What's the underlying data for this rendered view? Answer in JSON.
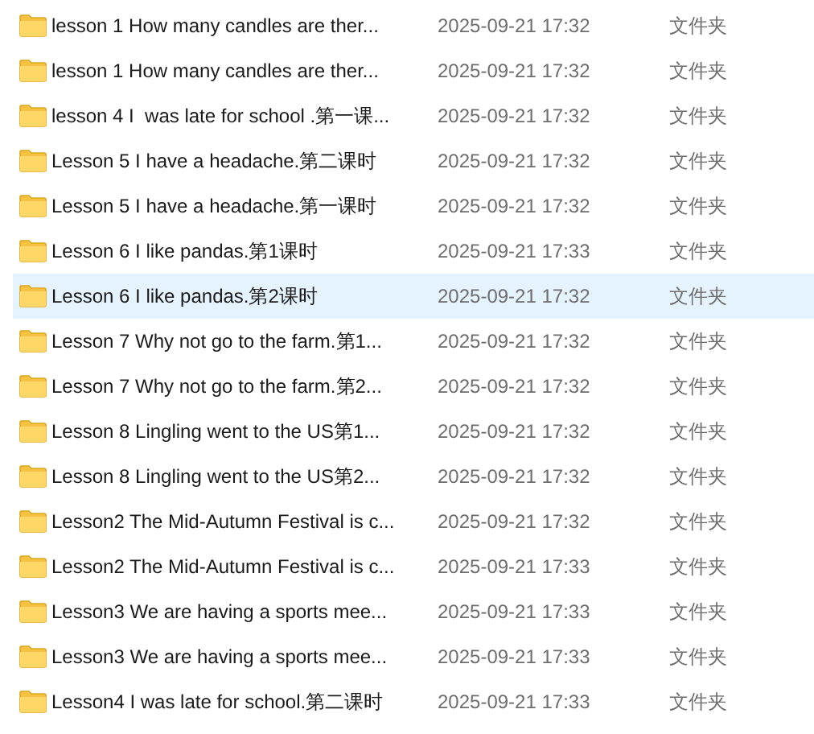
{
  "files": [
    {
      "name": "lesson 1 How many candles are ther...",
      "modified": "2025-09-21 17:32",
      "type": "文件夹",
      "selected": false
    },
    {
      "name": "lesson 1 How many candles are ther...",
      "modified": "2025-09-21 17:32",
      "type": "文件夹",
      "selected": false
    },
    {
      "name": "lesson 4 I  was late for school .第一课...",
      "modified": "2025-09-21 17:32",
      "type": "文件夹",
      "selected": false
    },
    {
      "name": "Lesson 5 I have a headache.第二课时",
      "modified": "2025-09-21 17:32",
      "type": "文件夹",
      "selected": false
    },
    {
      "name": "Lesson 5 I have a headache.第一课时",
      "modified": "2025-09-21 17:32",
      "type": "文件夹",
      "selected": false
    },
    {
      "name": "Lesson 6 I like pandas.第1课时",
      "modified": "2025-09-21 17:33",
      "type": "文件夹",
      "selected": false
    },
    {
      "name": "Lesson 6 I like pandas.第2课时",
      "modified": "2025-09-21 17:32",
      "type": "文件夹",
      "selected": true
    },
    {
      "name": "Lesson 7 Why not go to the farm.第1...",
      "modified": "2025-09-21 17:32",
      "type": "文件夹",
      "selected": false
    },
    {
      "name": "Lesson 7 Why not go to the farm.第2...",
      "modified": "2025-09-21 17:32",
      "type": "文件夹",
      "selected": false
    },
    {
      "name": "Lesson 8 Lingling went to the US第1...",
      "modified": "2025-09-21 17:32",
      "type": "文件夹",
      "selected": false
    },
    {
      "name": "Lesson 8 Lingling went to the US第2...",
      "modified": "2025-09-21 17:32",
      "type": "文件夹",
      "selected": false
    },
    {
      "name": "Lesson2 The Mid-Autumn Festival is c...",
      "modified": "2025-09-21 17:32",
      "type": "文件夹",
      "selected": false
    },
    {
      "name": "Lesson2 The Mid-Autumn Festival is c...",
      "modified": "2025-09-21 17:33",
      "type": "文件夹",
      "selected": false
    },
    {
      "name": "Lesson3 We are having a sports mee...",
      "modified": "2025-09-21 17:33",
      "type": "文件夹",
      "selected": false
    },
    {
      "name": "Lesson3 We are having a sports mee...",
      "modified": "2025-09-21 17:33",
      "type": "文件夹",
      "selected": false
    },
    {
      "name": "Lesson4 I was late for school.第二课时",
      "modified": "2025-09-21 17:33",
      "type": "文件夹",
      "selected": false
    }
  ]
}
